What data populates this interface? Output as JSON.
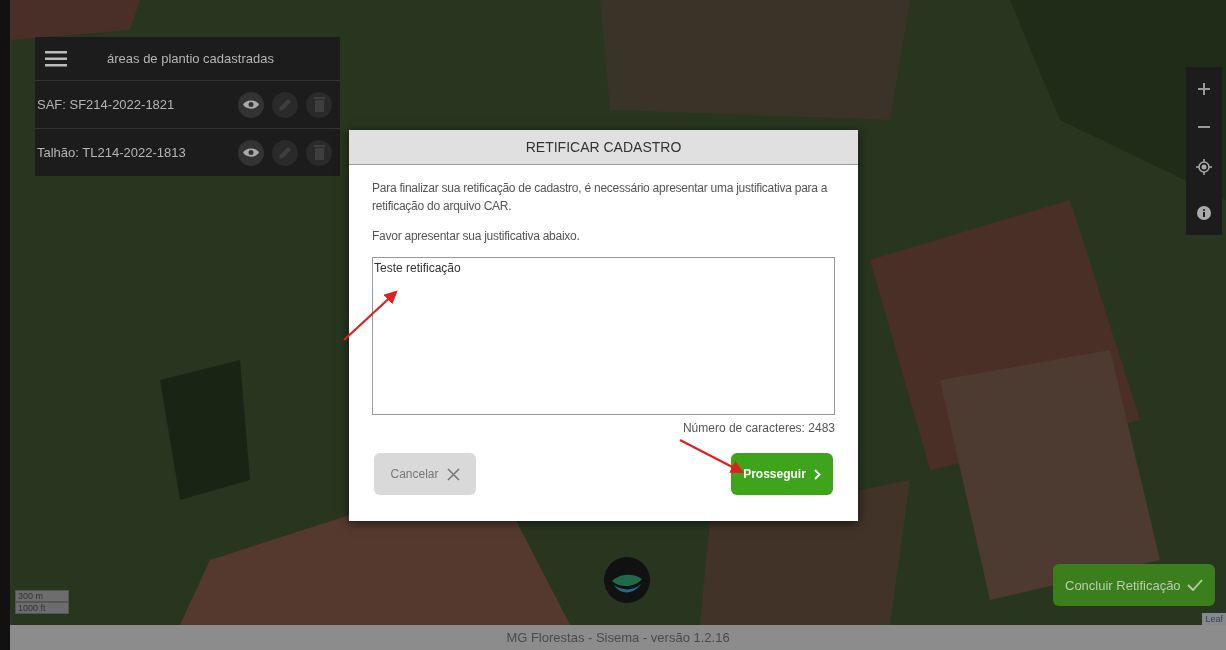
{
  "panel": {
    "title": "áreas de plantio cadastradas",
    "items": [
      {
        "label": "SAF: SF214-2022-1821"
      },
      {
        "label": "Talhão: TL214-2022-1813"
      }
    ]
  },
  "scale": [
    "300 m",
    "1000 ft"
  ],
  "attribution": "Leaf",
  "conclude_button": "Concluir Retificação",
  "modal": {
    "title": "RETIFICAR CADASTRO",
    "paragraphs": [
      "Para finalizar sua retificação de cadastro, é necessário apresentar uma justificativa para a retificação do arquivo CAR.",
      "Favor apresentar sua justificativa abaixo."
    ],
    "justification": "Teste retificação",
    "char_count": "Número de caracteres: 2483",
    "cancel": "Cancelar",
    "proceed": "Prosseguir"
  },
  "footer": "MG Florestas - Sisema - versão 1.2.16"
}
